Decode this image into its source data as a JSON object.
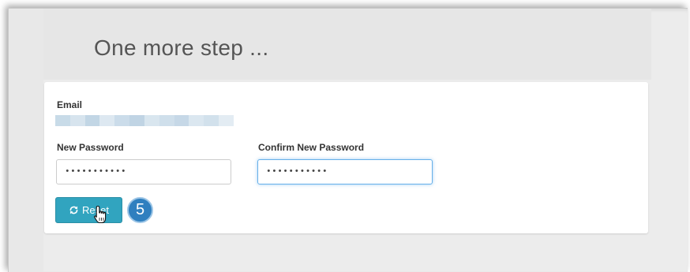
{
  "page": {
    "title": "One more step ..."
  },
  "form": {
    "email_label": "Email",
    "new_password_label": "New Password",
    "new_password_value": "•••••••••••",
    "confirm_password_label": "Confirm New Password",
    "confirm_password_value": "•••••••••••",
    "reset_label": "Reset",
    "reset_icon": "refresh-icon"
  },
  "annotation": {
    "step_number": "5"
  },
  "colors": {
    "primary_button": "#31a4bf",
    "step_badge": "#2f7fbf",
    "focus_ring": "#66afe9"
  }
}
